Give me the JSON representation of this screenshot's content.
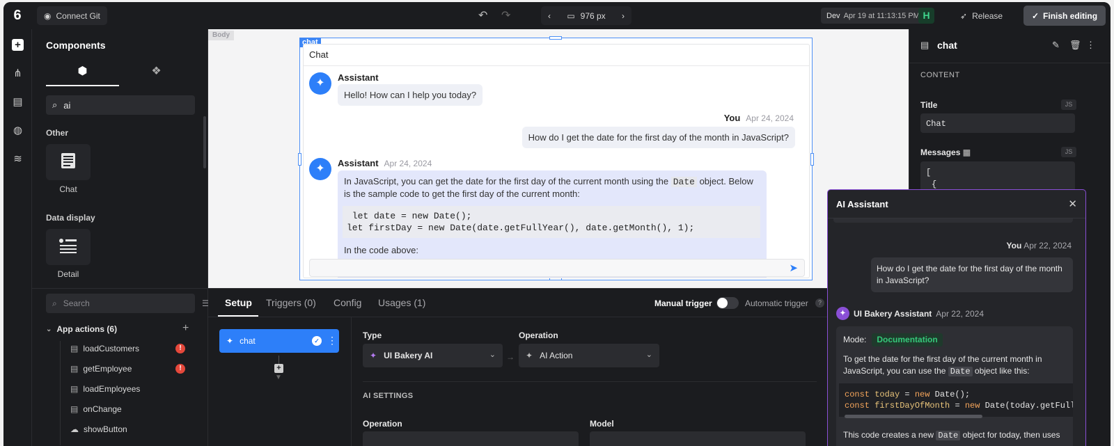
{
  "topbar": {
    "connect_git": "Connect Git",
    "viewport_width": "976 px",
    "env": "Dev",
    "env_time": "Apr 19 at 11:13:15 PM",
    "release": "Release",
    "finish_editing": "Finish editing"
  },
  "components_panel": {
    "title": "Components",
    "search_value": "ai",
    "sections": [
      {
        "label": "Other",
        "items": [
          {
            "name": "Chat"
          }
        ]
      },
      {
        "label": "Data display",
        "items": [
          {
            "name": "Detail"
          }
        ]
      }
    ]
  },
  "canvas": {
    "body_tag": "Body",
    "widget_tag": "chat",
    "chat_title": "Chat",
    "messages": [
      {
        "sender": "Assistant",
        "date": "",
        "text": "Hello! How can I help you today?"
      },
      {
        "sender": "You",
        "date": "Apr 24, 2024",
        "text": "How do I get the date for the first day of the month in JavaScript?"
      },
      {
        "sender": "Assistant",
        "date": "Apr 24, 2024",
        "text_before": "In JavaScript, you can get the date for the first day of the current month using the",
        "inline_code": "Date",
        "text_after": "object. Below is the sample code to get the first day of the current month:",
        "code": " let date = new Date();\nlet firstDay = new Date(date.getFullYear(), date.getMonth(), 1);",
        "text_end": "In the code above:"
      }
    ]
  },
  "inspector": {
    "title": "chat",
    "content_label": "CONTENT",
    "title_label": "Title",
    "title_value": "Chat",
    "messages_label": "Messages",
    "js_badge": "JS",
    "messages_value_line1": "[",
    "messages_value_line2": "{"
  },
  "actions_panel": {
    "search_placeholder": "Search",
    "group_label": "App actions (6)",
    "items": [
      {
        "name": "loadCustomers",
        "error": "!"
      },
      {
        "name": "getEmployee",
        "error": "!"
      },
      {
        "name": "loadEmployees"
      },
      {
        "name": "onChange"
      },
      {
        "name": "showButton"
      }
    ]
  },
  "editor": {
    "tabs": [
      "Setup",
      "Triggers (0)",
      "Config",
      "Usages (1)"
    ],
    "manual_trigger": "Manual trigger",
    "automatic_trigger": "Automatic trigger",
    "help": "?",
    "step_name": "chat",
    "type_label": "Type",
    "type_value": "UI Bakery AI",
    "operation_label": "Operation",
    "operation_value": "AI Action",
    "ai_settings": "AI SETTINGS",
    "bottom_operation_label": "Operation",
    "model_label": "Model"
  },
  "ai_assistant": {
    "title": "AI Assistant",
    "user_name": "You",
    "user_date": "Apr 22, 2024",
    "user_message": "How do I get the date for the first day of the month in JavaScript?",
    "bot_name": "UI Bakery Assistant",
    "bot_date": "Apr 22, 2024",
    "mode_label": "Mode:",
    "mode_value": "Documentation",
    "reply_before": "To get the date for the first day of the current month in JavaScript, you can use the",
    "reply_inline": "Date",
    "reply_after": "object like this:",
    "code_line1_kw": "const",
    "code_line1_var": "today",
    "code_line1_rest": " = ",
    "code_line1_new": "new",
    "code_line1_end": " Date();",
    "code_line2_kw": "const",
    "code_line2_var": "firstDayOfMonth",
    "code_line2_rest": " = ",
    "code_line2_new": "new",
    "code_line2_end": " Date(today.getFullY",
    "trailing_before": "This code creates a new",
    "trailing_inline": "Date",
    "trailing_after": "object for today, then uses"
  },
  "colors": {
    "accent_blue": "#2d7ff9",
    "ai_purple": "#8a4fd6",
    "error_red": "#e5483b",
    "success_green": "#35c97a"
  }
}
